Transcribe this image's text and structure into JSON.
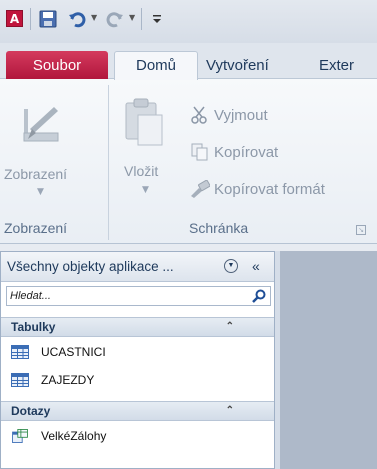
{
  "qat": {
    "app_icon_letter": "A",
    "icons": [
      "save-icon",
      "undo-icon",
      "redo-icon",
      "customize-icon"
    ]
  },
  "tabs": {
    "file": "Soubor",
    "home": "Domů",
    "create": "Vytvoření",
    "external": "Exter"
  },
  "ribbon": {
    "view_group": {
      "button_label": "Zobrazení",
      "group_label": "Zobrazení"
    },
    "clipboard_group": {
      "paste_label": "Vložit",
      "cut_label": "Vyjmout",
      "copy_label": "Kopírovat",
      "format_painter_label": "Kopírovat formát",
      "group_label": "Schránka"
    }
  },
  "nav_pane": {
    "header": "Všechny objekty aplikace ...",
    "search_placeholder": "Hledat...",
    "groups": [
      {
        "label": "Tabulky",
        "items": [
          "UCASTNICI",
          "ZAJEZDY"
        ]
      },
      {
        "label": "Dotazy",
        "items": [
          "VelkéZálohy"
        ]
      }
    ]
  },
  "colors": {
    "file_tab": "#c0143c",
    "accent": "#1e395b"
  }
}
